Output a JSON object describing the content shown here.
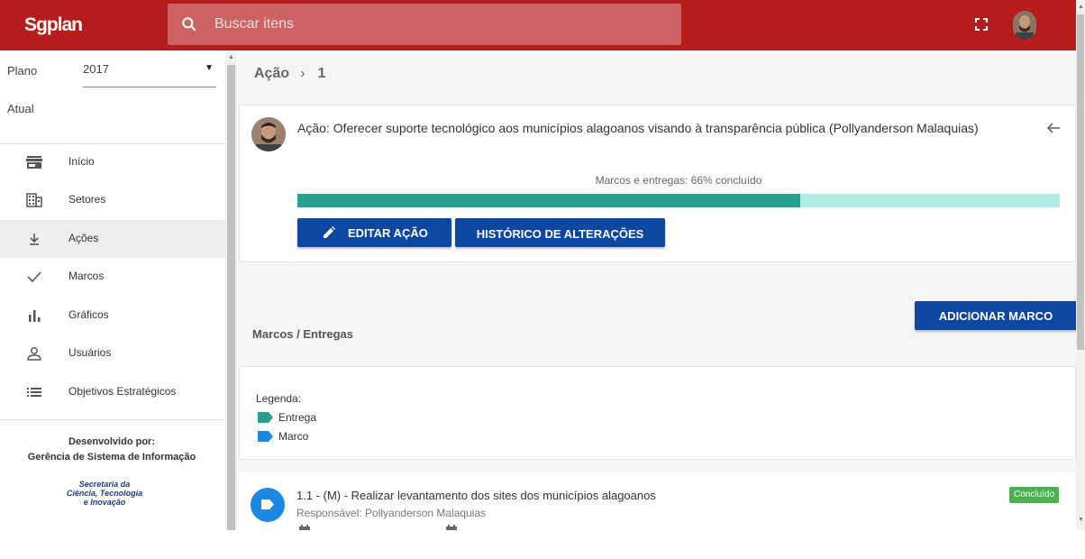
{
  "header": {
    "brand": "Sgplan",
    "search_placeholder": "Buscar itens",
    "bar_color": "#b71c1c"
  },
  "sidebar": {
    "plano_label": "Plano",
    "plano_value": "2017",
    "atual_label": "Atual",
    "items": [
      {
        "label": "Início",
        "icon": "store-icon"
      },
      {
        "label": "Setores",
        "icon": "building-icon"
      },
      {
        "label": "Ações",
        "icon": "download-arrow-icon",
        "active": true
      },
      {
        "label": "Marcos",
        "icon": "check-icon"
      },
      {
        "label": "Gráficos",
        "icon": "bar-chart-icon"
      },
      {
        "label": "Usuários",
        "icon": "user-icon"
      },
      {
        "label": "Objetivos Estratégicos",
        "icon": "list-icon"
      }
    ],
    "dev_label": "Desenvolvido por:",
    "dev_org": "Gerência de Sistema de Informação",
    "logo_lines": [
      "Secretaria da",
      "Ciência, Tecnologia",
      "e Inovação"
    ]
  },
  "main": {
    "breadcrumb": [
      "Ação",
      "1"
    ],
    "action_title": "Ação: Oferecer suporte tecnológico aos municípios alagoanos visando à transparência pública (Pollyanderson Malaquias)",
    "progress_label": "Marcos e entregas: 66% concluído",
    "progress_percent": 66,
    "edit_button": "EDITAR AÇÃO",
    "history_button": "HISTÓRICO DE ALTERAÇÕES",
    "marcos_title": "Marcos / Entregas",
    "add_button": "ADICIONAR MARCO",
    "legend_title": "Legenda:",
    "legend": [
      {
        "label": "Entrega",
        "color": "#26a08f"
      },
      {
        "label": "Marco",
        "color": "#1e88e5"
      }
    ],
    "milestone": {
      "title": "1.1 - (M) - Realizar levantamento dos sites dos municípios alagoanos",
      "responsavel": "Responsável: Pollyanderson Malaquias",
      "status": "Concluído"
    }
  }
}
